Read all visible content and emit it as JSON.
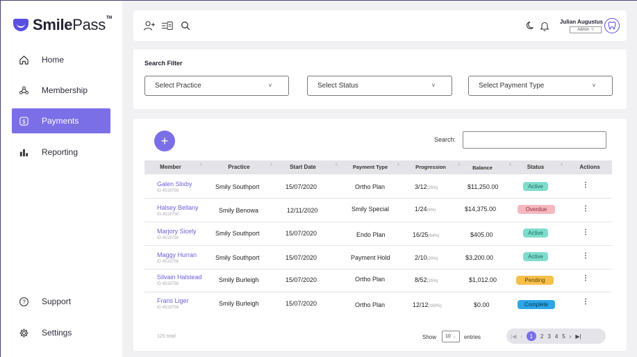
{
  "brand": {
    "name_bold": "Smile",
    "name_light": "Pass",
    "tm": "TM"
  },
  "nav": {
    "home": "Home",
    "membership": "Membership",
    "payments": "Payments",
    "reporting": "Reporting",
    "support": "Support",
    "settings": "Settings"
  },
  "user": {
    "name": "Julian Augustus",
    "role": "Admin"
  },
  "filter": {
    "title": "Search Filter",
    "practice": "Select Practice",
    "status": "Select Status",
    "payment_type": "Select Payment Type"
  },
  "table": {
    "search_label": "Search:",
    "headers": [
      "Member",
      "Practice",
      "Start Date",
      "Payment Type",
      "Progression",
      "Balance",
      "Status",
      "Actions"
    ],
    "rows": [
      {
        "name": "Galen Slixby",
        "id": "ID 4519758",
        "practice": "Smily Southport",
        "date": "15/07/2020",
        "type": "Ortho Plan",
        "prog": "3/12",
        "pct": "(25%)",
        "balance": "$11,250.00",
        "status": "Active"
      },
      {
        "name": "Halsey Bellany",
        "id": "ID 4519758",
        "practice": "Smily Benowa",
        "date": "12/11/2020",
        "type": "Smily Special",
        "prog": "1/24",
        "pct": "(4%)",
        "balance": "$14,375.00",
        "status": "Overdue"
      },
      {
        "name": "Marjory Sicely",
        "id": "ID 4519758",
        "practice": "Smily Southport",
        "date": "15/07/2020",
        "type": "Endo Plan",
        "prog": "16/25",
        "pct": "(64%)",
        "balance": "$405.00",
        "status": "Active"
      },
      {
        "name": "Maggy Hurran",
        "id": "ID 4519758",
        "practice": "Smily Southport",
        "date": "15/07/2020",
        "type": "Payment Hold",
        "prog": "2/10",
        "pct": "(20%)",
        "balance": "$3,200.00",
        "status": "Active"
      },
      {
        "name": "Silvain Halstead",
        "id": "ID 4519758",
        "practice": "Smily Burleigh",
        "date": "15/07/2020",
        "type": "Ortho Plan",
        "prog": "8/52",
        "pct": "(15%)",
        "balance": "$1,012.00",
        "status": "Pending"
      },
      {
        "name": "Frans Liger",
        "id": "ID 4519758",
        "practice": "Smily Burleigh",
        "date": "15/07/2020",
        "type": "Ortho Plan",
        "prog": "12/12",
        "pct": "(100%)",
        "balance": "$0.00",
        "status": "Complete"
      }
    ],
    "total": "125 total",
    "show": "Show",
    "page_size": "10",
    "entries": "entries",
    "pages": [
      "1",
      "2",
      "3",
      "4",
      "5"
    ]
  },
  "colors": {
    "accent": "#7b6fe8",
    "active_bg": "#7fdccd",
    "overdue_bg": "#f6b8c0",
    "pending_bg": "#f7c04a",
    "complete_bg": "#2ba6e6"
  }
}
